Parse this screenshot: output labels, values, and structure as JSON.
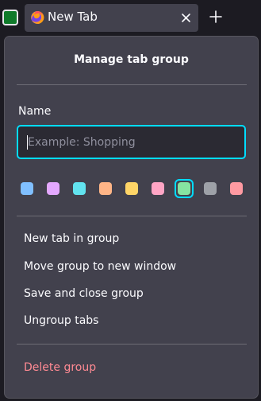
{
  "tab": {
    "title": "New Tab"
  },
  "group": {
    "color": "#0f7a2a"
  },
  "panel": {
    "title": "Manage tab group",
    "name_label": "Name",
    "name_placeholder": "Example: Shopping",
    "colors": [
      {
        "name": "blue",
        "hex": "#80bfff",
        "selected": false
      },
      {
        "name": "purple",
        "hex": "#e4a8ff",
        "selected": false
      },
      {
        "name": "cyan",
        "hex": "#62e3ef",
        "selected": false
      },
      {
        "name": "orange",
        "hex": "#ffb587",
        "selected": false
      },
      {
        "name": "yellow",
        "hex": "#ffd567",
        "selected": false
      },
      {
        "name": "pink",
        "hex": "#ffa5c5",
        "selected": false
      },
      {
        "name": "green",
        "hex": "#86e3a1",
        "selected": true
      },
      {
        "name": "gray",
        "hex": "#9ea1a8",
        "selected": false
      },
      {
        "name": "red",
        "hex": "#ff9aa2",
        "selected": false
      }
    ],
    "menu": [
      {
        "label": "New tab in group"
      },
      {
        "label": "Move group to new window"
      },
      {
        "label": "Save and close group"
      },
      {
        "label": "Ungroup tabs"
      }
    ],
    "delete_label": "Delete group"
  },
  "colors": {
    "accent": "#00ddff",
    "panel_bg": "#42414d",
    "text": "#fbfbfe",
    "danger": "#ff8a93"
  }
}
